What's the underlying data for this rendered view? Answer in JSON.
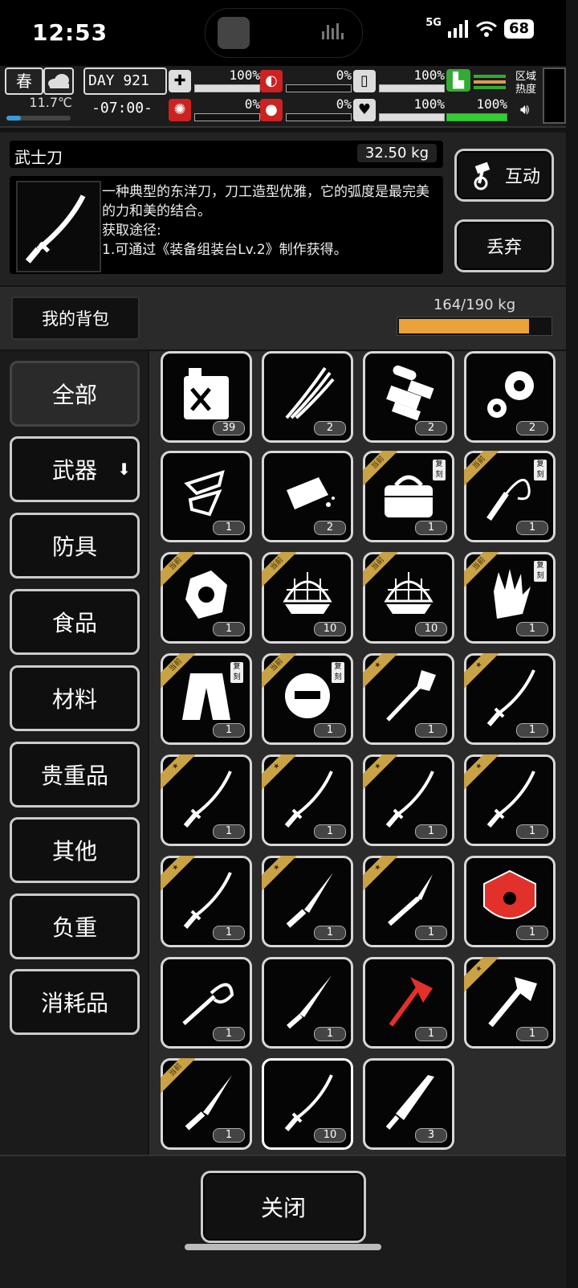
{
  "status": {
    "time": "12:53",
    "network": "5G",
    "battery": "68"
  },
  "hud": {
    "season": "春",
    "temperature": "11.7℃",
    "day": "DAY 921",
    "clock": "-07:00-",
    "stats": [
      {
        "icon": "medkit-icon",
        "value": "100%",
        "fill": 1.0
      },
      {
        "icon": "stomach-icon",
        "value": "0%",
        "fill": 0.0
      },
      {
        "icon": "drink-icon",
        "value": "100%",
        "fill": 1.0
      },
      {
        "icon": "brain-icon",
        "value": "0%",
        "fill": 0.0
      },
      {
        "icon": "blood-icon",
        "value": "0%",
        "fill": 0.0
      },
      {
        "icon": "heart-icon",
        "value": "100%",
        "fill": 1.0
      },
      {
        "icon": "stamina-icon",
        "value": "100%",
        "fill": 1.0
      }
    ],
    "region_label": "区域\n热度"
  },
  "detail": {
    "name": "武士刀",
    "weight": "32.50 kg",
    "description": "一种典型的东洋刀，刀工造型优雅，它的弧度是最完美的力和美的结合。\n获取途径:\n1.可通过《装备组装台Lv.2》制作获得。",
    "interact_label": "互动",
    "drop_label": "丢弃"
  },
  "bag": {
    "label": "我的背包",
    "capacity": "164/190 kg",
    "fill": 0.863
  },
  "categories": [
    "全部",
    "武器",
    "防具",
    "食品",
    "材料",
    "贵重品",
    "其他",
    "负重",
    "消耗品"
  ],
  "ribbon_label": "当前",
  "copy_label": "复刻",
  "items": [
    {
      "icon": "fuel-can-icon",
      "count": "39"
    },
    {
      "icon": "fiber-bundle-icon",
      "count": "2"
    },
    {
      "icon": "machine-parts-icon",
      "count": "2"
    },
    {
      "icon": "gears-icon",
      "count": "2"
    },
    {
      "icon": "cloth-scrap-icon",
      "count": "1"
    },
    {
      "icon": "stone-block-icon",
      "count": "2"
    },
    {
      "icon": "bag-icon",
      "count": "1",
      "ribbon": true,
      "copy": true
    },
    {
      "icon": "whip-icon",
      "count": "1",
      "ribbon": true,
      "copy": true
    },
    {
      "icon": "armor-shard-icon",
      "count": "1",
      "ribbon": true
    },
    {
      "icon": "net-trap-icon",
      "count": "10",
      "ribbon": true
    },
    {
      "icon": "net-trap-icon",
      "count": "10",
      "ribbon": true
    },
    {
      "icon": "chain-glove-icon",
      "count": "1",
      "ribbon": true,
      "copy": true
    },
    {
      "icon": "jacket-icon",
      "count": "1",
      "ribbon": true,
      "copy": true
    },
    {
      "icon": "helmet-icon",
      "count": "1",
      "ribbon": true,
      "copy": true
    },
    {
      "icon": "shovel-icon",
      "count": "1",
      "star": true
    },
    {
      "icon": "katana-icon",
      "count": "1",
      "star": true
    },
    {
      "icon": "katana-icon",
      "count": "1",
      "star": true
    },
    {
      "icon": "katana-icon",
      "count": "1",
      "star": true
    },
    {
      "icon": "katana-icon",
      "count": "1",
      "star": true
    },
    {
      "icon": "katana-icon",
      "count": "1",
      "star": true
    },
    {
      "icon": "katana-icon",
      "count": "1",
      "star": true
    },
    {
      "icon": "knife-icon",
      "count": "1",
      "star": true
    },
    {
      "icon": "scalpel-icon",
      "count": "1",
      "star": true
    },
    {
      "icon": "red-shield-icon",
      "count": "1"
    },
    {
      "icon": "rapier-icon",
      "count": "1"
    },
    {
      "icon": "dagger-icon",
      "count": "1"
    },
    {
      "icon": "red-axe-icon",
      "count": "1"
    },
    {
      "icon": "hatchet-icon",
      "count": "1",
      "star": true
    },
    {
      "icon": "knife-icon",
      "count": "1",
      "ribbon": true
    },
    {
      "icon": "katana-icon",
      "count": "10",
      "selected": true
    },
    {
      "icon": "machete-icon",
      "count": "3"
    }
  ],
  "footer": {
    "close_label": "关闭"
  }
}
